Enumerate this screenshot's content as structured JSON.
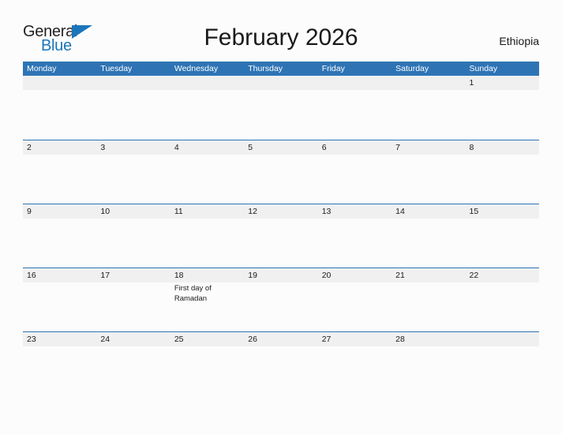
{
  "brand": {
    "name_part1": "General",
    "name_part2": "Blue",
    "accent_color": "#1b75bb"
  },
  "header": {
    "title": "February 2026",
    "country": "Ethiopia"
  },
  "calendar": {
    "header_color": "#2e74b5",
    "band_color": "#f0f0f0",
    "weekdays": [
      "Monday",
      "Tuesday",
      "Wednesday",
      "Thursday",
      "Friday",
      "Saturday",
      "Sunday"
    ],
    "weeks": [
      [
        {
          "date": "",
          "event": ""
        },
        {
          "date": "",
          "event": ""
        },
        {
          "date": "",
          "event": ""
        },
        {
          "date": "",
          "event": ""
        },
        {
          "date": "",
          "event": ""
        },
        {
          "date": "",
          "event": ""
        },
        {
          "date": "1",
          "event": ""
        }
      ],
      [
        {
          "date": "2",
          "event": ""
        },
        {
          "date": "3",
          "event": ""
        },
        {
          "date": "4",
          "event": ""
        },
        {
          "date": "5",
          "event": ""
        },
        {
          "date": "6",
          "event": ""
        },
        {
          "date": "7",
          "event": ""
        },
        {
          "date": "8",
          "event": ""
        }
      ],
      [
        {
          "date": "9",
          "event": ""
        },
        {
          "date": "10",
          "event": ""
        },
        {
          "date": "11",
          "event": ""
        },
        {
          "date": "12",
          "event": ""
        },
        {
          "date": "13",
          "event": ""
        },
        {
          "date": "14",
          "event": ""
        },
        {
          "date": "15",
          "event": ""
        }
      ],
      [
        {
          "date": "16",
          "event": ""
        },
        {
          "date": "17",
          "event": ""
        },
        {
          "date": "18",
          "event": "First day of Ramadan"
        },
        {
          "date": "19",
          "event": ""
        },
        {
          "date": "20",
          "event": ""
        },
        {
          "date": "21",
          "event": ""
        },
        {
          "date": "22",
          "event": ""
        }
      ],
      [
        {
          "date": "23",
          "event": ""
        },
        {
          "date": "24",
          "event": ""
        },
        {
          "date": "25",
          "event": ""
        },
        {
          "date": "26",
          "event": ""
        },
        {
          "date": "27",
          "event": ""
        },
        {
          "date": "28",
          "event": ""
        },
        {
          "date": "",
          "event": ""
        }
      ]
    ]
  }
}
